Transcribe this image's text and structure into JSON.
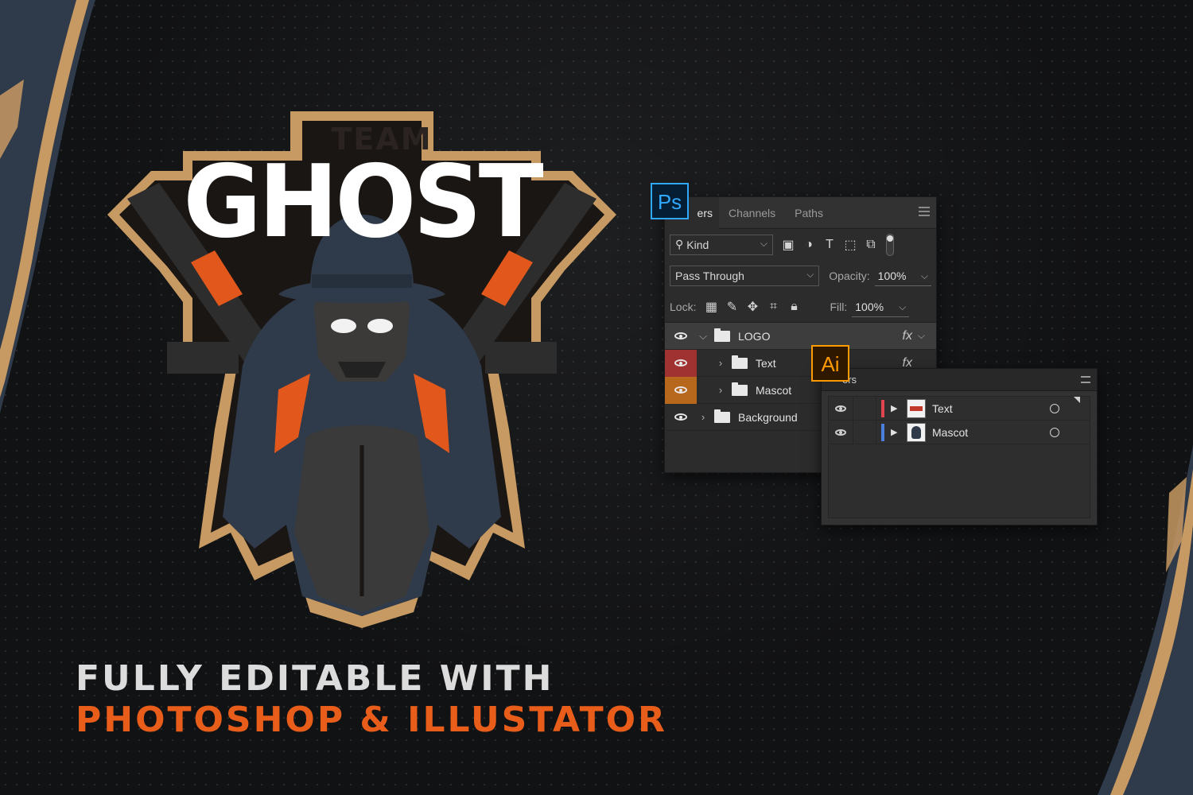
{
  "logo": {
    "team": "TEAM",
    "name": "GHOST"
  },
  "colors": {
    "tan": "#c89a63",
    "orange": "#e85d1a",
    "navy": "#2f3a4a",
    "ps_blue": "#31a8ff",
    "ai_orange": "#ff9a00"
  },
  "photoshop": {
    "badge": "Ps",
    "tabs": [
      "ers",
      "Channels",
      "Paths"
    ],
    "filter_kind": "Kind",
    "blend_mode": "Pass Through",
    "opacity_label": "Opacity:",
    "opacity_value": "100%",
    "lock_label": "Lock:",
    "fill_label": "Fill:",
    "fill_value": "100%",
    "layers": [
      {
        "name": "LOGO",
        "fx": "fx",
        "expanded": true
      },
      {
        "name": "Text",
        "fx": "fx"
      },
      {
        "name": "Mascot"
      },
      {
        "name": "Background"
      }
    ]
  },
  "illustrator": {
    "badge": "Ai",
    "title": "ers",
    "layers": [
      {
        "name": "Text",
        "color": "#e0454f"
      },
      {
        "name": "Mascot",
        "color": "#4a7fdc"
      }
    ]
  },
  "headline": {
    "line1": "FULLY EDITABLE WITH",
    "line2": "PHOTOSHOP & ILLUSTATOR"
  }
}
